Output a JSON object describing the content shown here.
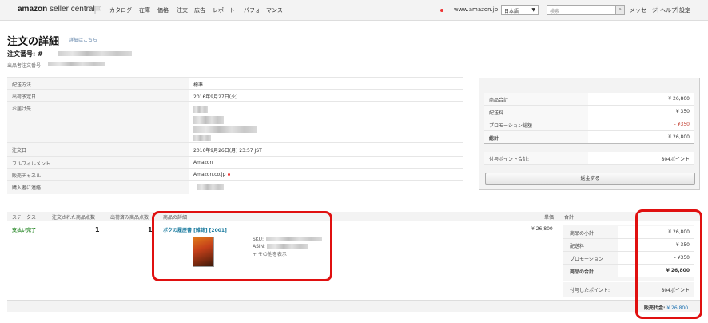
{
  "nav": {
    "logo_brand": "amazon",
    "logo_sub": "seller central",
    "items": [
      "カタログ",
      "在庫",
      "価格",
      "注文",
      "広告",
      "レポート",
      "パフォーマンス"
    ],
    "marketplace": "www.amazon.jp",
    "language": "日本語",
    "search_placeholder": "検索",
    "search_icon": "magnifier-icon",
    "links": [
      "メッセージ",
      "ヘルプ",
      "設定"
    ]
  },
  "header": {
    "title": "注文の詳細",
    "detail_link": "詳細はこちら",
    "order_number_label": "注文番号: #",
    "seller_order_label": "出品者注文番号"
  },
  "info": {
    "rows": [
      {
        "label": "配送方法",
        "value": "標準"
      },
      {
        "label": "出荷予定日",
        "value": "2016年9月27日(火)"
      },
      {
        "label": "お届け先",
        "value": ""
      },
      {
        "label": "注文日",
        "value": "2016年9月26日(月) 23:57 JST"
      },
      {
        "label": "フルフィルメント",
        "value": "Amazon"
      },
      {
        "label": "販売チャネル",
        "value": "Amazon.co.jp"
      },
      {
        "label": "購入者に連絡",
        "value": ""
      }
    ]
  },
  "summary": {
    "rows": [
      {
        "label": "商品合計",
        "value": "¥ 26,800"
      },
      {
        "label": "配送料",
        "value": "¥ 350"
      },
      {
        "label": "プロモーション総額",
        "value": "- ¥350"
      },
      {
        "label": "総計",
        "value": "¥ 26,800"
      }
    ],
    "points_label": "付与ポイント合計:",
    "points_value": "804ポイント",
    "refund_button": "返金する"
  },
  "items": {
    "headers": [
      "ステータス",
      "注文された商品点数",
      "出荷済み商品点数",
      "商品の詳細",
      "単価",
      "合計"
    ],
    "status": "支払い完了",
    "ordered_qty": "1",
    "shipped_qty": "1",
    "product_name": "ボクの履歴書 [雑誌] [2001]",
    "sku_label": "SKU:",
    "asin_label": "ASIN:",
    "more_link": "+ その他を表示",
    "unit_price": "¥ 26,800",
    "subtotal_rows": [
      {
        "label": "商品の小計",
        "value": "¥ 26,800"
      },
      {
        "label": "配送料",
        "value": "¥ 350"
      },
      {
        "label": "プロモーション",
        "value": "- ¥350"
      },
      {
        "label": "商品の合計",
        "value": "¥ 26,800"
      }
    ],
    "points_label": "付与したポイント:",
    "points_value": "804ポイント",
    "sales_label": "販売代金:",
    "sales_value": "¥ 26,800"
  },
  "colors": {
    "highlight": "#e01010",
    "status_green": "#2e8b2e",
    "link_blue": "#1a7a9e"
  }
}
